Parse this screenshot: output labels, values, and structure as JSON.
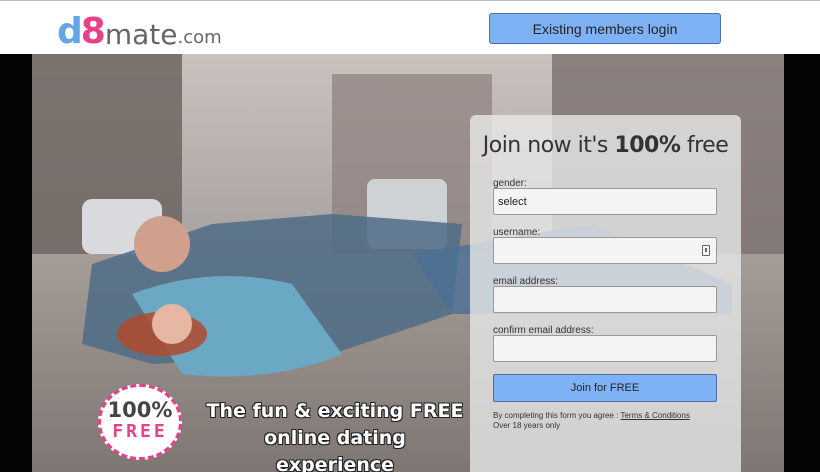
{
  "logo": {
    "part1": "d",
    "part2": "8",
    "part3": "mate",
    "part4": ".com"
  },
  "header": {
    "login_label": "Existing members login"
  },
  "form": {
    "title_pre": "Join now it's ",
    "title_bold": "100%",
    "title_post": " free",
    "gender_label": "gender:",
    "gender_value": "select",
    "username_label": "username:",
    "email_label": "email address:",
    "confirm_label": "confirm email address:",
    "join_label": "Join for FREE",
    "terms_prefix": "By completing this form you agree : ",
    "terms_link": "Terms & Conditions",
    "terms_line2": "Over 18 years only"
  },
  "badge": {
    "pct": "100%",
    "free": "FREE"
  },
  "tagline": {
    "line1": "The fun & exciting FREE",
    "line2": "online dating experience"
  },
  "colors": {
    "brand_blue": "#64a6e6",
    "brand_pink": "#e9408a",
    "button": "#7fb2f5"
  }
}
